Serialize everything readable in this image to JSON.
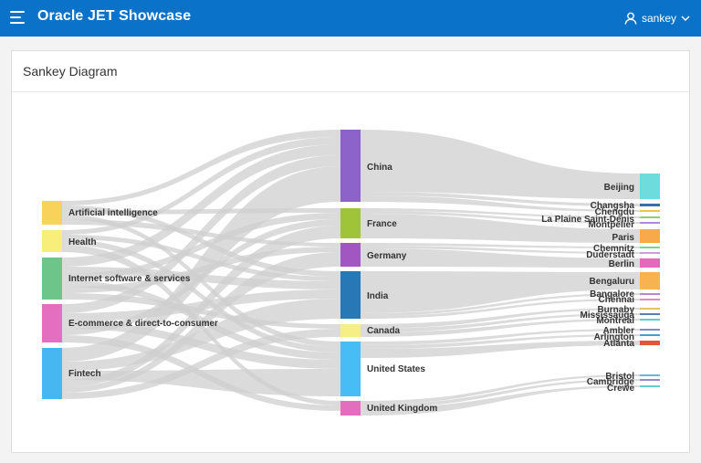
{
  "header": {
    "app_title": "Oracle JET Showcase",
    "user_name": "sankey",
    "menu_icon": "hamburger-icon",
    "user_icon": "user-icon",
    "dropdown_icon": "chevron-down-icon"
  },
  "card": {
    "title": "Sankey Diagram"
  },
  "sankey": {
    "colors": {
      "link": "#cfcfcf",
      "background": "#ffffff",
      "header_bar": "#0a72c9"
    },
    "columns": [
      {
        "nodes": [
          {
            "label": "Artificial intelligence",
            "color": "#f9d25b"
          },
          {
            "label": "Health",
            "color": "#f7ef7a"
          },
          {
            "label": "Internet software & services",
            "color": "#6dc58a"
          },
          {
            "label": "E-commerce & direct-to-consumer",
            "color": "#e46fc0"
          },
          {
            "label": "Fintech",
            "color": "#46b7f1"
          }
        ]
      },
      {
        "nodes": [
          {
            "label": "China",
            "color": "#8b63c9"
          },
          {
            "label": "France",
            "color": "#9fc437"
          },
          {
            "label": "Germany",
            "color": "#a156c1"
          },
          {
            "label": "India",
            "color": "#2778b4"
          },
          {
            "label": "Canada",
            "color": "#f6ef85"
          },
          {
            "label": "United States",
            "color": "#46bdf4"
          },
          {
            "label": "United Kingdom",
            "color": "#e26fbd"
          }
        ]
      },
      {
        "nodes": [
          {
            "label": "Beijing",
            "color": "#6edcdc"
          },
          {
            "label": "Changsha",
            "color": "#3a6fa8"
          },
          {
            "label": "Chengdu",
            "color": "#e9c64a"
          },
          {
            "label": "La Plaine Saint-Denis",
            "color": "#8fd06e"
          },
          {
            "label": "Montpelier",
            "color": "#b188db"
          },
          {
            "label": "Paris",
            "color": "#f7a94b"
          },
          {
            "label": "Chemnitz",
            "color": "#7dd48a"
          },
          {
            "label": "Duderstadt",
            "color": "#c79ee0"
          },
          {
            "label": "Berlin",
            "color": "#e26ab8"
          },
          {
            "label": "Bengaluru",
            "color": "#f7b350"
          },
          {
            "label": "Bangalore",
            "color": "#b389d6"
          },
          {
            "label": "Chennai",
            "color": "#e58ac4"
          },
          {
            "label": "Burnaby",
            "color": "#e5c25a"
          },
          {
            "label": "Mississauga",
            "color": "#5b7fb4"
          },
          {
            "label": "Montreal",
            "color": "#5fd0cc"
          },
          {
            "label": "Ambler",
            "color": "#7f8fc5"
          },
          {
            "label": "Arlington",
            "color": "#4b9bd1"
          },
          {
            "label": "Atlanta",
            "color": "#e2553c"
          },
          {
            "label": "Bristol",
            "color": "#6fb7d8"
          },
          {
            "label": "Cambridge",
            "color": "#9a88d0"
          },
          {
            "label": "Crewe",
            "color": "#62d0cf"
          }
        ]
      }
    ]
  }
}
